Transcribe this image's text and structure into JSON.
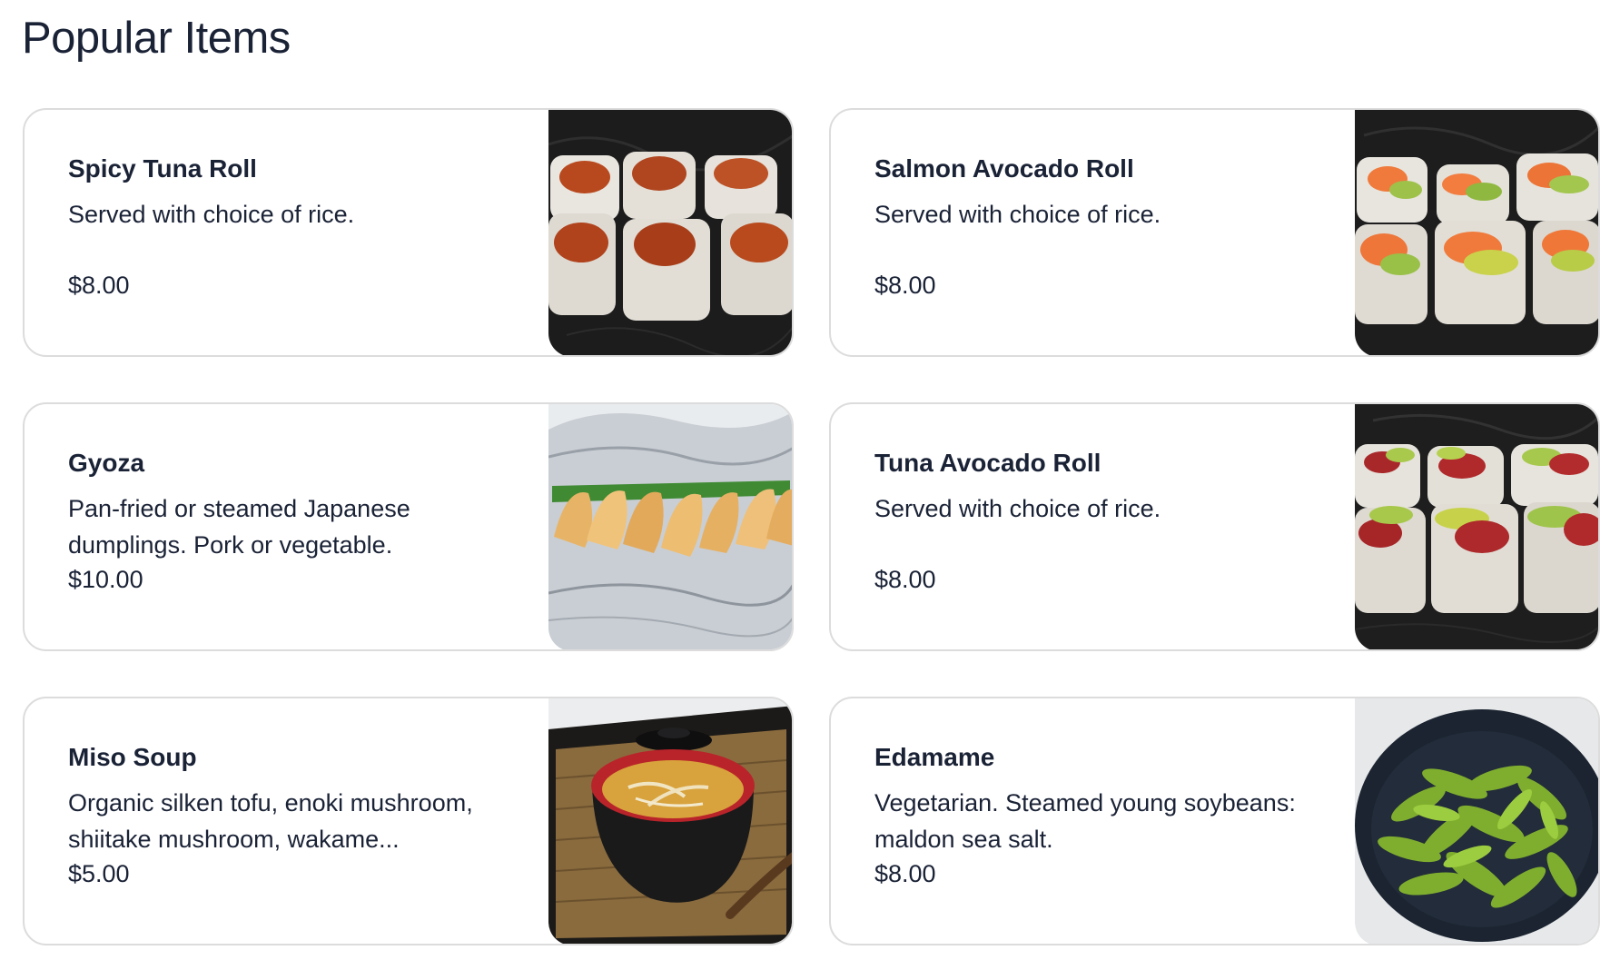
{
  "section": {
    "title": "Popular Items"
  },
  "items": [
    {
      "name": "Spicy Tuna Roll",
      "description": "Served with choice of rice.",
      "price": "$8.00",
      "image_icon": "spicy-tuna-roll-photo"
    },
    {
      "name": "Salmon Avocado Roll",
      "description": "Served with choice of rice.",
      "price": "$8.00",
      "image_icon": "salmon-avocado-roll-photo"
    },
    {
      "name": "Gyoza",
      "description": "Pan-fried or steamed Japanese dumplings. Pork or vegetable.",
      "price": "$10.00",
      "image_icon": "gyoza-photo"
    },
    {
      "name": "Tuna Avocado Roll",
      "description": "Served with choice of rice.",
      "price": "$8.00",
      "image_icon": "tuna-avocado-roll-photo"
    },
    {
      "name": "Miso Soup",
      "description": "Organic silken tofu, enoki mushroom, shiitake mushroom, wakame...",
      "price": "$5.00",
      "image_icon": "miso-soup-photo"
    },
    {
      "name": "Edamame",
      "description": "Vegetarian. Steamed young soybeans: maldon sea salt.",
      "price": "$8.00",
      "image_icon": "edamame-photo"
    }
  ],
  "colors": {
    "text": "#1a2236",
    "border": "#dcdcdc",
    "background": "#ffffff"
  }
}
